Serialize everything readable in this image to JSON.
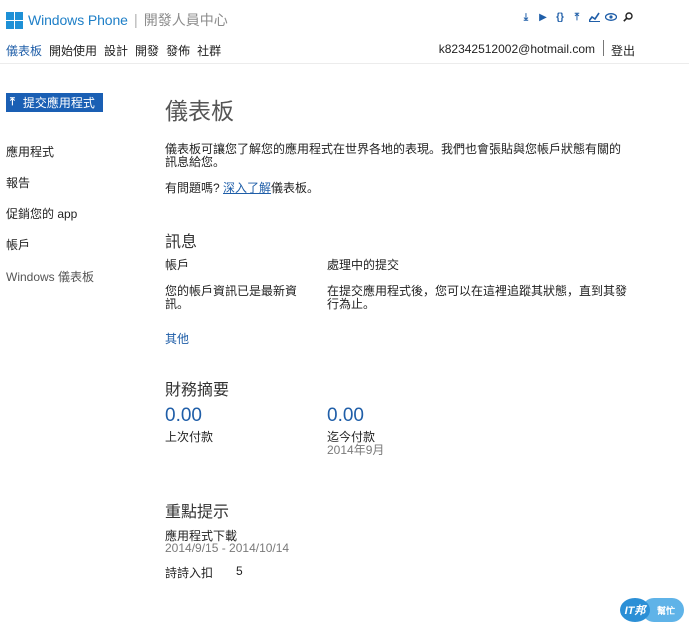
{
  "header": {
    "brand": "Windows Phone",
    "separator": "|",
    "subtitle": "開發人員中心",
    "icons": [
      "download-icon",
      "play-icon",
      "code-braces-icon",
      "upload-icon",
      "chart-icon",
      "eye-icon",
      "search-icon"
    ]
  },
  "nav": {
    "items": [
      {
        "label": "儀表板",
        "active": true
      },
      {
        "label": "開始使用"
      },
      {
        "label": "設計"
      },
      {
        "label": "開發"
      },
      {
        "label": "發佈"
      },
      {
        "label": "社群"
      }
    ],
    "account_email": "k82342512002@hotmail.com",
    "logout": "登出"
  },
  "sidebar": {
    "submit_button": "提交應用程式",
    "items": [
      {
        "label": "應用程式"
      },
      {
        "label": "報告"
      },
      {
        "label": "促銷您的 app"
      },
      {
        "label": "帳戶"
      },
      {
        "label": "Windows 儀表板"
      }
    ]
  },
  "main": {
    "title": "儀表板",
    "intro_line1": "儀表板可讓您了解您的應用程式在世界各地的表現。我們也會張貼與您帳戶狀態有關的",
    "intro_line2": "訊息給您。",
    "question_prefix": "有問題嗎? ",
    "question_link": "深入了解",
    "question_suffix": "儀表板。",
    "messages": {
      "heading": "訊息",
      "account_label": "帳戶",
      "account_desc_line1": "您的帳戶資訊已是最新資",
      "account_desc_line2": "訊。",
      "processing_label": "處理中的提交",
      "processing_desc_line1": "在提交應用程式後，您可以在這裡追蹤其狀態，直到其發",
      "processing_desc_line2": "行為止。",
      "more": "其他"
    },
    "financial": {
      "heading": "財務摘要",
      "last_payment_amount": "0.00",
      "last_payment_label": "上次付款",
      "to_date_amount": "0.00",
      "to_date_label": "迄今付款",
      "to_date_period": "2014年9月"
    },
    "highlights": {
      "heading": "重點提示",
      "downloads_label": "應用程式下載",
      "downloads_range": "2014/9/15 - 2014/10/14",
      "in_app_label": "詩詩入扣",
      "in_app_value": "5"
    }
  },
  "watermark": {
    "left": "IT邦",
    "right": "幫忙"
  },
  "colors": {
    "accent": "#1f5ea8",
    "brand_blue": "#1e7fc7",
    "button_bg": "#1a5fb4"
  }
}
